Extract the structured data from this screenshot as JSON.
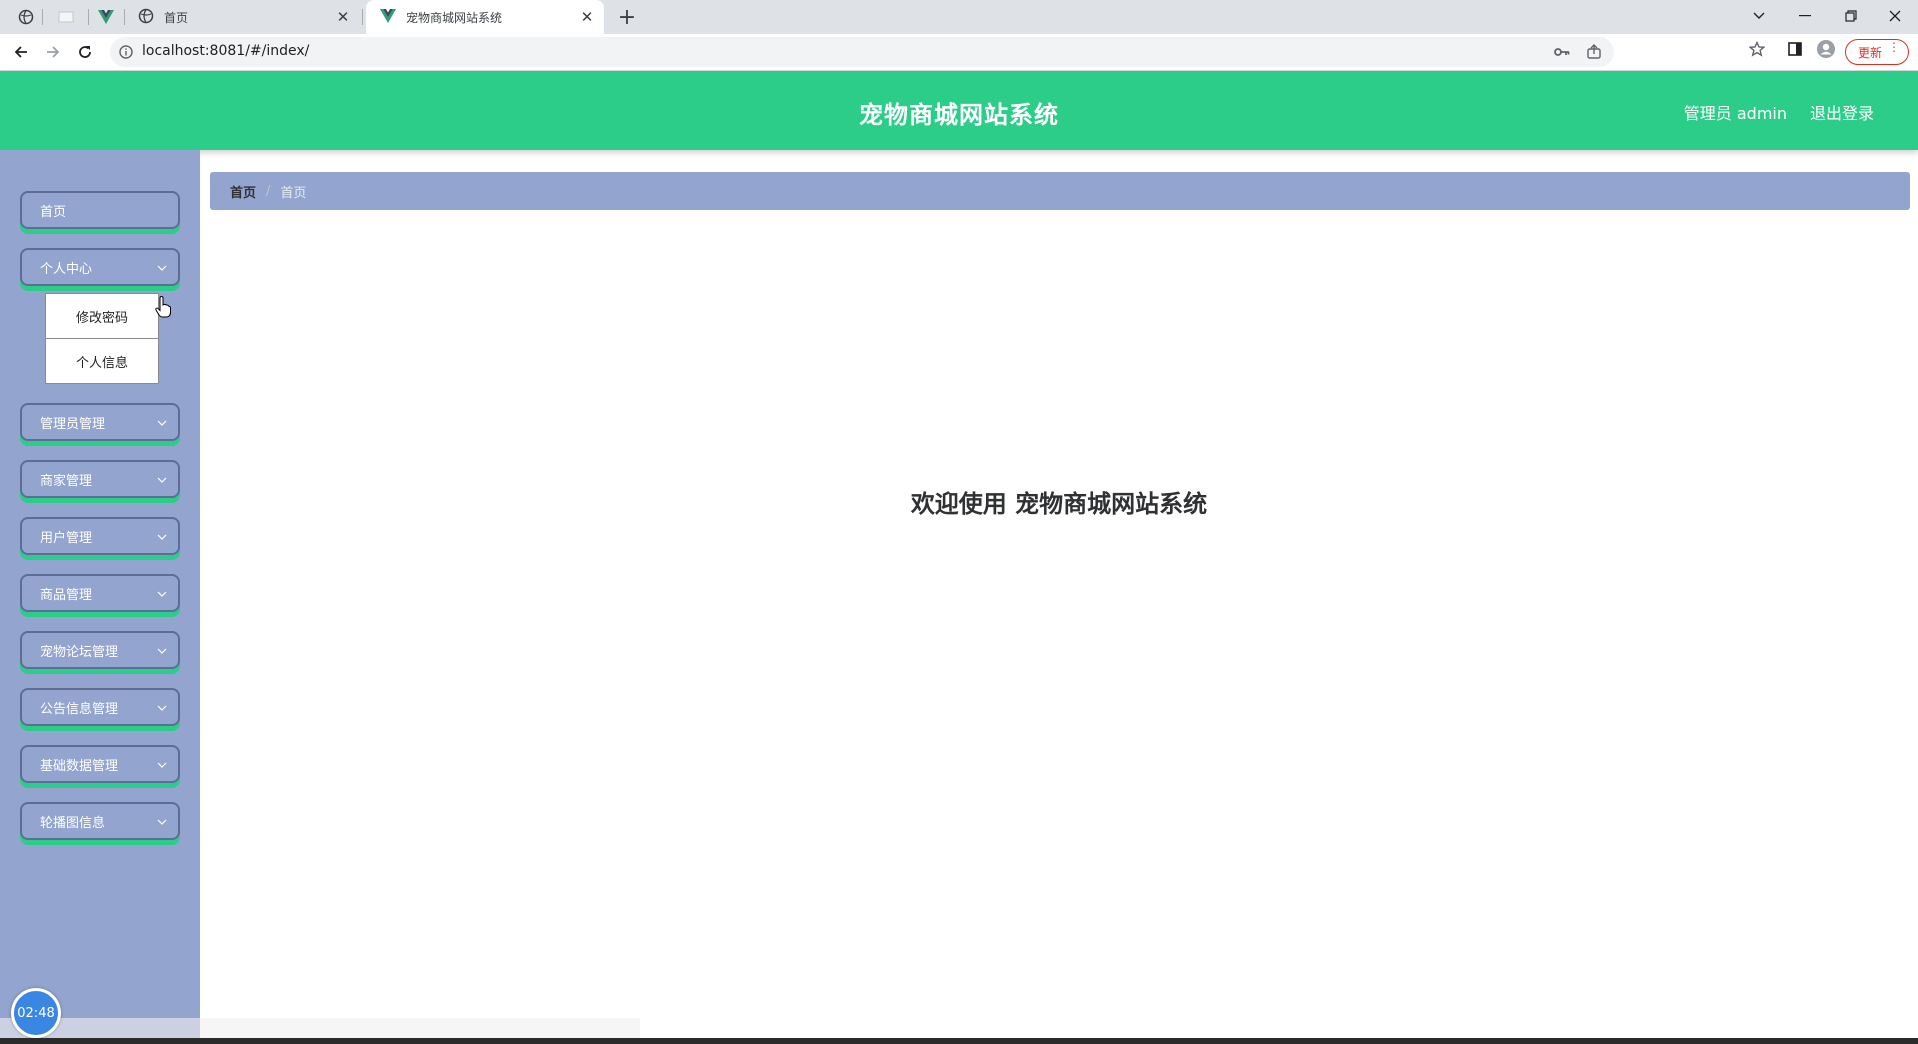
{
  "browser": {
    "tabs": [
      {
        "title": "首页",
        "active": false
      },
      {
        "title": "宠物商城网站系统",
        "active": true
      }
    ],
    "url": "localhost:8081/#/index/",
    "update_label": "更新"
  },
  "header": {
    "title": "宠物商城网站系统",
    "admin_label": "管理员 admin",
    "logout_label": "退出登录",
    "accent_color": "#2bcd89"
  },
  "sidebar": {
    "items": [
      {
        "label": "首页",
        "has_submenu": false
      },
      {
        "label": "个人中心",
        "has_submenu": true,
        "expanded": true
      },
      {
        "label": "管理员管理",
        "has_submenu": true
      },
      {
        "label": "商家管理",
        "has_submenu": true
      },
      {
        "label": "用户管理",
        "has_submenu": true
      },
      {
        "label": "商品管理",
        "has_submenu": true
      },
      {
        "label": "宠物论坛管理",
        "has_submenu": true
      },
      {
        "label": "公告信息管理",
        "has_submenu": true
      },
      {
        "label": "基础数据管理",
        "has_submenu": true
      },
      {
        "label": "轮播图信息",
        "has_submenu": true
      }
    ],
    "submenu": [
      "修改密码",
      "个人信息"
    ],
    "background_color": "#93a4cf"
  },
  "breadcrumb": [
    "首页",
    "首页"
  ],
  "main": {
    "welcome_text": "欢迎使用 宠物商城网站系统"
  },
  "clock": "02:48"
}
